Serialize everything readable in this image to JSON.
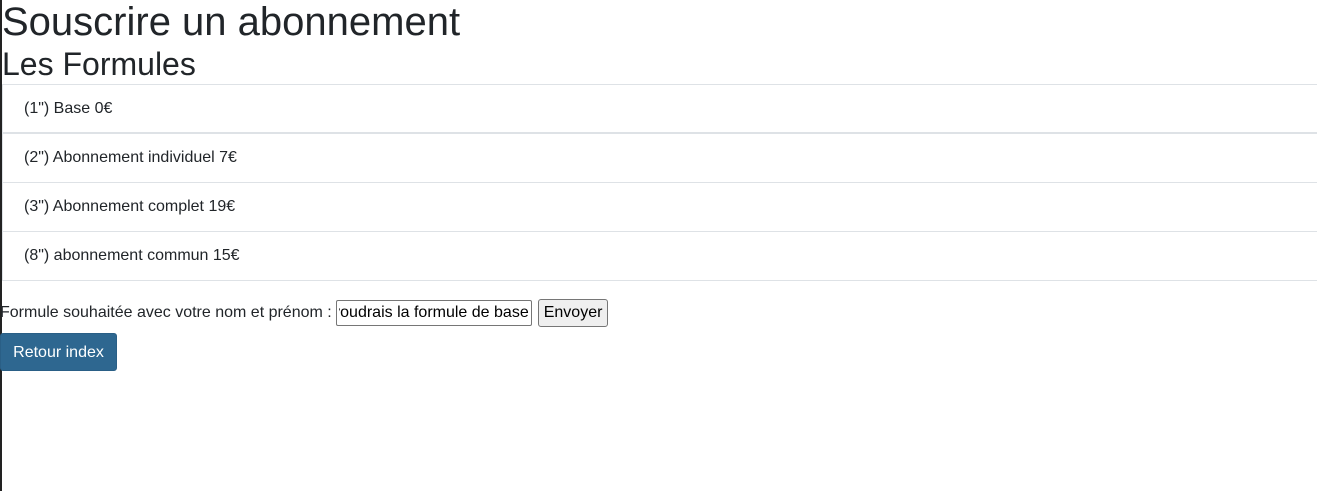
{
  "page": {
    "title": "Souscrire un abonnement",
    "section_title": "Les Formules"
  },
  "formulas": [
    {
      "label": "(1\") Base 0€"
    },
    {
      "label": "(2\") Abonnement individuel 7€"
    },
    {
      "label": "(3\") Abonnement complet 19€"
    },
    {
      "label": "(8\") abonnement commun 15€"
    }
  ],
  "form": {
    "label": "Formule souhaitée avec votre nom et prénom :",
    "input_value": "Je voudrais la formule de base",
    "submit_label": "Envoyer"
  },
  "navigation": {
    "back_label": "Retour index"
  },
  "colors": {
    "primary_button": "#2e6790",
    "text": "#212529",
    "divider": "#dee2e6"
  }
}
